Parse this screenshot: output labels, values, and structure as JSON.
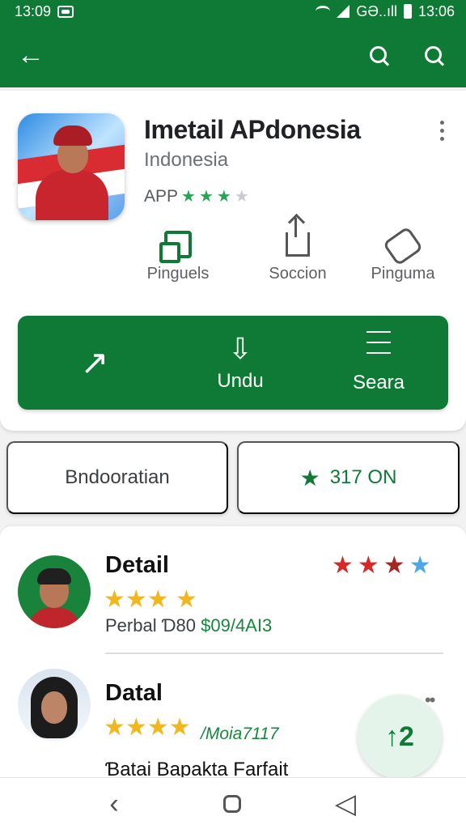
{
  "status": {
    "time": "13:09",
    "signal_text": "GƏ..ıll",
    "right_time": "13:06"
  },
  "app_bar": {
    "back_icon": "arrow-left-icon",
    "search_icon": "search-icon"
  },
  "app": {
    "title": "Imetail APdonesia",
    "subtitle": "Indonesia",
    "type_label": "APP",
    "rating_stars": 3,
    "more_icon": "more-vert-icon",
    "actions": [
      {
        "label": "Pinguels",
        "icon": "copy-icon"
      },
      {
        "label": "Soccion",
        "icon": "share-icon"
      },
      {
        "label": "Pinguma",
        "icon": "pin-icon"
      }
    ]
  },
  "green_panel": {
    "buttons": [
      {
        "label": "",
        "icon": "cursor-icon"
      },
      {
        "label": "Undu",
        "icon": "download-icon"
      },
      {
        "label": "Seara",
        "icon": "menu-icon"
      }
    ]
  },
  "chips": {
    "left_label": "Bndooratian",
    "right_label": "317 ON",
    "right_icon": "star-icon"
  },
  "details": [
    {
      "title": "Detail",
      "stars": "★★★ ★",
      "top_rating": "★★★★",
      "meta_prefix": "Perbal Ɗ80",
      "meta_value": "$09/4AI3"
    },
    {
      "title": "Datal",
      "stars": "★★★★",
      "review_meta": "/Moia7117",
      "text": "Ɓatai Bapakta Farfait"
    }
  ],
  "fab": {
    "label": "↑2"
  },
  "navigation": {
    "back": "‹",
    "recent": "◁"
  },
  "colors": {
    "primary": "#0e7a35",
    "accent_green": "#2aa456",
    "star_gold": "#f2b71b",
    "star_red": "#d72727",
    "star_dark_red": "#a62622",
    "star_blue": "#4ea5e8"
  }
}
